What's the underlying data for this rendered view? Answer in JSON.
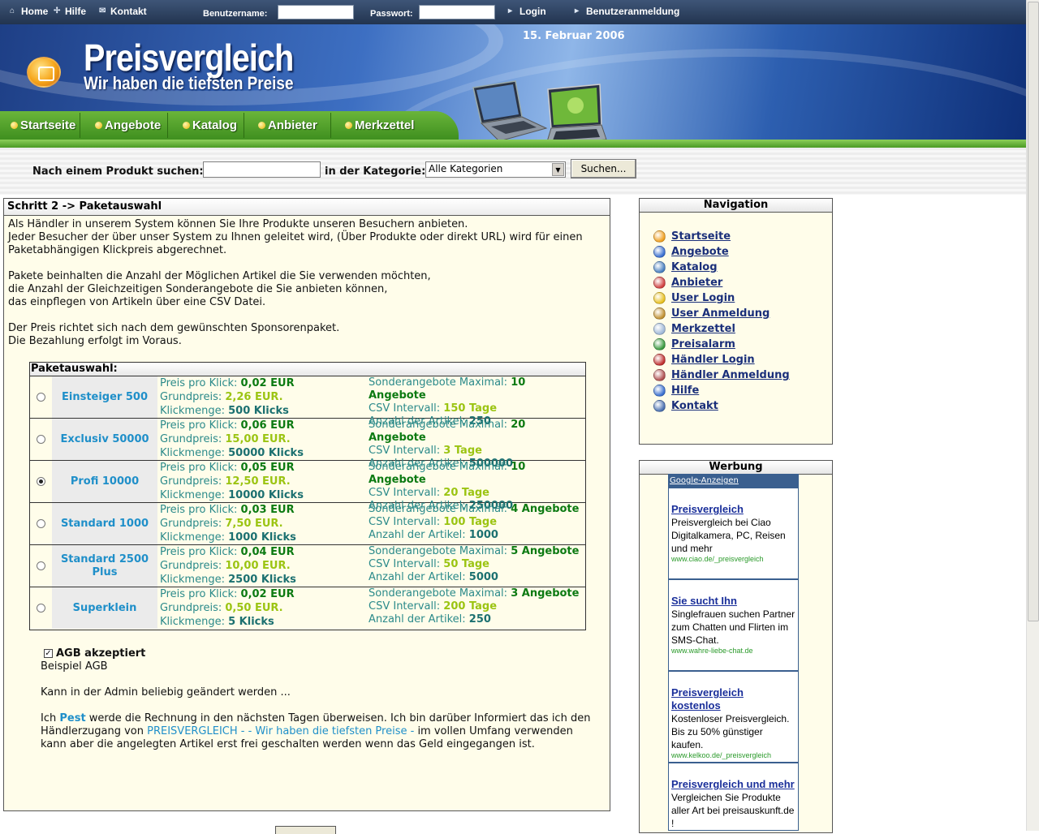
{
  "topbar": {
    "home": "Home",
    "help": "Hilfe",
    "contact": "Kontakt",
    "username_label": "Benutzername:",
    "password_label": "Passwort:",
    "login": "Login",
    "register": "Benutzeranmeldung"
  },
  "header": {
    "title": "Preisvergleich",
    "subtitle": "Wir haben die tiefsten Preise",
    "date": "15. Februar 2006"
  },
  "mainnav": [
    "Startseite",
    "Angebote",
    "Katalog",
    "Anbieter",
    "Merkzettel"
  ],
  "search": {
    "label": "Nach einem Produkt suchen:",
    "category_label": "in der Kategorie:",
    "category_value": "Alle Kategorien",
    "button": "Suchen..."
  },
  "main": {
    "title": "Schritt 2 -> Paketauswahl",
    "intro": [
      "Als Händler in unserem System können Sie Ihre Produkte unseren Besuchern anbieten.",
      "Jeder Besucher der über unser System zu Ihnen geleitet wird, (Über Produkte oder direkt URL) wird für einen",
      "Paketabhängigen Klickpreis abgerechnet.",
      "Pakete beinhalten die Anzahl der Möglichen Artikel die Sie verwenden möchten,",
      "die Anzahl der Gleichzeitigen Sonderangebote die Sie anbieten können,",
      "das einpflegen von Artikeln über eine CSV Datei.",
      "Der Preis richtet sich nach dem gewünschten Sponsorenpaket.",
      "Die Bezahlung erfolgt im Voraus."
    ],
    "packages_title": "Paketauswahl:",
    "labels": {
      "price_per_click": "Preis pro Klick:",
      "base_price": "Grundpreis:",
      "click_amount": "Klickmenge:",
      "special_max": "Sonderangebote Maximal:",
      "csv_interval": "CSV Intervall:",
      "article_count": "Anzahl der Artikel:"
    },
    "packages": [
      {
        "name": "Einsteiger 500",
        "selected": false,
        "ppc": "0,02 EUR",
        "base": "2,26 EUR.",
        "clicks": "500 Klicks",
        "special": "10 Angebote",
        "csv": "150 Tage",
        "articles": "250"
      },
      {
        "name": "Exclusiv 50000",
        "selected": false,
        "ppc": "0,06 EUR",
        "base": "15,00 EUR.",
        "clicks": "50000 Klicks",
        "special": "20 Angebote",
        "csv": "3 Tage",
        "articles": "500000"
      },
      {
        "name": "Profi 10000",
        "selected": true,
        "ppc": "0,05 EUR",
        "base": "12,50 EUR.",
        "clicks": "10000 Klicks",
        "special": "10 Angebote",
        "csv": "20 Tage",
        "articles": "250000"
      },
      {
        "name": "Standard 1000",
        "selected": false,
        "ppc": "0,03 EUR",
        "base": "7,50 EUR.",
        "clicks": "1000 Klicks",
        "special": "4 Angebote",
        "csv": "100 Tage",
        "articles": "1000"
      },
      {
        "name": "Standard 2500 Plus",
        "selected": false,
        "ppc": "0,04 EUR",
        "base": "10,00 EUR.",
        "clicks": "2500 Klicks",
        "special": "5 Angebote",
        "csv": "50 Tage",
        "articles": "5000"
      },
      {
        "name": "Superklein",
        "selected": false,
        "ppc": "0,02 EUR",
        "base": "0,50 EUR.",
        "clicks": "5 Klicks",
        "special": "3 Angebote",
        "csv": "200 Tage",
        "articles": "250"
      }
    ],
    "agb": {
      "accepted_label": "AGB akzeptiert",
      "line1": "Beispiel AGB",
      "line2": "Kann in der Admin beliebig geändert werden ...",
      "p_start": "Ich ",
      "user": "Pest",
      "p_mid": " werde die Rechnung in den nächsten Tagen überweisen. Ich bin darüber Informiert das ich den Händlerzugang von ",
      "site": "PREISVERGLEICH - - Wir haben die tiefsten Preise -",
      "p_end": " im vollen Umfang verwenden kann aber die angelegten Artikel erst frei geschalten werden wenn das Geld eingegangen ist."
    }
  },
  "sidebar": {
    "nav_title": "Navigation",
    "nav_items": [
      {
        "label": "Startseite",
        "color": "#f0a020"
      },
      {
        "label": "Angebote",
        "color": "#3a6fd0"
      },
      {
        "label": "Katalog",
        "color": "#4a80c0"
      },
      {
        "label": "Anbieter",
        "color": "#d04040"
      },
      {
        "label": "User Login",
        "color": "#e8c020"
      },
      {
        "label": "User Anmeldung",
        "color": "#c09030"
      },
      {
        "label": "Merkzettel",
        "color": "#9fb8d8"
      },
      {
        "label": "Preisalarm",
        "color": "#3a9a40"
      },
      {
        "label": "Händler Login",
        "color": "#c03030"
      },
      {
        "label": "Händler Anmeldung",
        "color": "#b05050"
      },
      {
        "label": "Hilfe",
        "color": "#3a70d0"
      },
      {
        "label": "Kontakt",
        "color": "#4a70b0"
      }
    ],
    "ads_title": "Werbung",
    "ads_header": "Google-Anzeigen",
    "ads": [
      {
        "title": "Preisvergleich",
        "body": "Preisvergleich bei Ciao Digitalkamera, PC, Reisen und mehr",
        "url": "www.ciao.de/_preisvergleich"
      },
      {
        "title": "Sie sucht Ihn",
        "body": "Singlefrauen suchen Partner zum Chatten und Flirten im SMS-Chat.",
        "url": "www.wahre-liebe-chat.de"
      },
      {
        "title": "Preisvergleich kostenlos",
        "body": "Kostenloser Preisvergleich. Bis zu 50% günstiger kaufen.",
        "url": "www.kelkoo.de/_preisvergleich"
      },
      {
        "title": "Preisvergleich und mehr",
        "body": "Vergleichen Sie Produkte aller Art bei preisauskunft.de !",
        "url": ""
      }
    ]
  }
}
